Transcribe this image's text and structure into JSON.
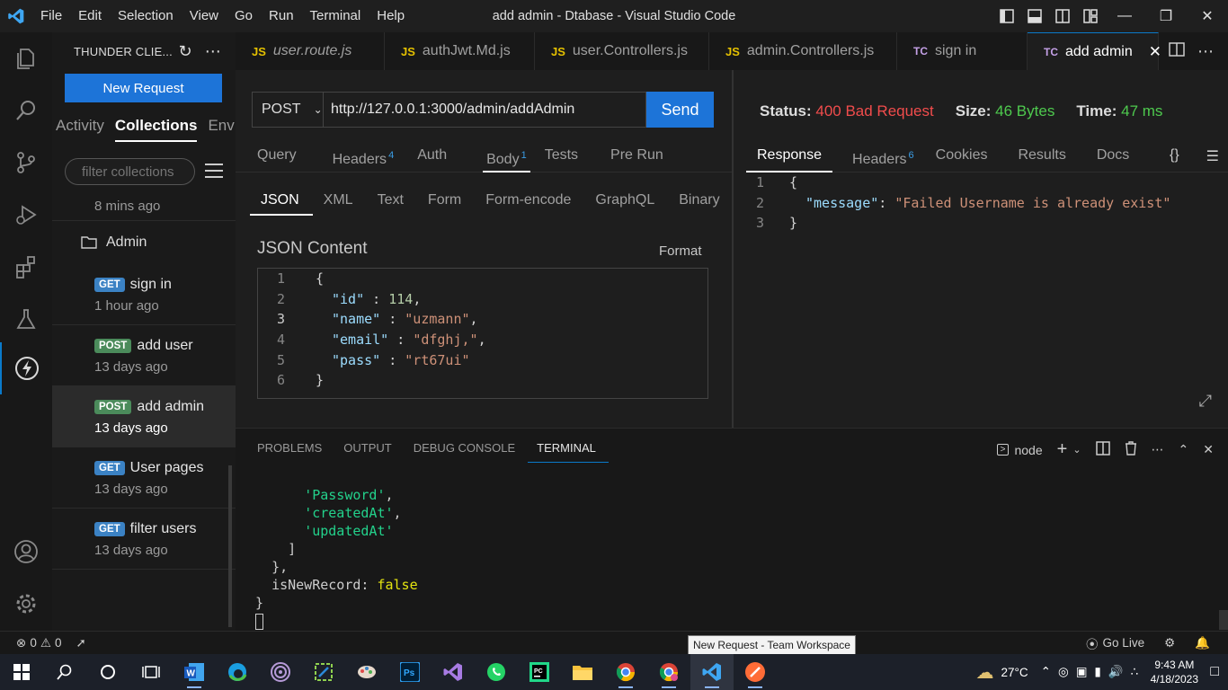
{
  "window": {
    "title": "add admin - Dtabase - Visual Studio Code"
  },
  "menu": [
    "File",
    "Edit",
    "Selection",
    "View",
    "Go",
    "Run",
    "Terminal",
    "Help"
  ],
  "sidebar": {
    "title": "THUNDER CLIE...",
    "new_request": "New Request",
    "tabs": [
      "Activity",
      "Collections",
      "Env"
    ],
    "filter_placeholder": "filter collections",
    "top_time": "8 mins ago",
    "folder": "Admin",
    "items": [
      {
        "method": "GET",
        "name": "sign in",
        "time": "1 hour ago"
      },
      {
        "method": "POST",
        "name": "add user",
        "time": "13 days ago"
      },
      {
        "method": "POST",
        "name": "add admin",
        "time": "13 days ago"
      },
      {
        "method": "GET",
        "name": "User pages",
        "time": "13 days ago"
      },
      {
        "method": "GET",
        "name": "filter users",
        "time": "13 days ago"
      }
    ]
  },
  "tabs": [
    {
      "badge": "JS",
      "name": "user.route.js"
    },
    {
      "badge": "JS",
      "name": "authJwt.Md.js"
    },
    {
      "badge": "JS",
      "name": "user.Controllers.js"
    },
    {
      "badge": "JS",
      "name": "admin.Controllers.js"
    },
    {
      "badge": "TC",
      "name": "sign in"
    },
    {
      "badge": "TC",
      "name": "add admin"
    }
  ],
  "request": {
    "method": "POST",
    "url": "http://127.0.0.1:3000/admin/addAdmin",
    "send": "Send",
    "tabs": {
      "query": "Query",
      "headers": "Headers",
      "headers_count": "4",
      "auth": "Auth",
      "body": "Body",
      "body_count": "1",
      "tests": "Tests",
      "prerun": "Pre Run"
    },
    "body_tabs": [
      "JSON",
      "XML",
      "Text",
      "Form",
      "Form-encode",
      "GraphQL",
      "Binary"
    ],
    "json_title": "JSON Content",
    "format": "Format",
    "body_lines": [
      {
        "n": "1",
        "t": "{"
      },
      {
        "n": "2",
        "key": "\"id\"",
        "sep": " : ",
        "num": "114",
        "end": ","
      },
      {
        "n": "3",
        "key": "\"name\"",
        "sep": " : ",
        "str": "\"uzmann\"",
        "end": ","
      },
      {
        "n": "4",
        "key": "\"email\"",
        "sep": " : ",
        "str": "\"dfghj,\"",
        "end": ","
      },
      {
        "n": "5",
        "key": "\"pass\"",
        "sep": " : ",
        "str": "\"rt67ui\"",
        "end": ""
      },
      {
        "n": "6",
        "t": "}"
      }
    ]
  },
  "response": {
    "status_label": "Status:",
    "status_value": "400 Bad Request",
    "size_label": "Size:",
    "size_value": "46 Bytes",
    "time_label": "Time:",
    "time_value": "47 ms",
    "tabs": {
      "response": "Response",
      "headers": "Headers",
      "headers_count": "6",
      "cookies": "Cookies",
      "results": "Results",
      "docs": "Docs"
    },
    "lines": [
      {
        "n": "1",
        "t": "{"
      },
      {
        "n": "2",
        "key": "\"message\"",
        "sep": ": ",
        "str": "\"Failed Username is already exist\""
      },
      {
        "n": "3",
        "t": "}"
      }
    ]
  },
  "panel": {
    "tabs": [
      "PROBLEMS",
      "OUTPUT",
      "DEBUG CONSOLE",
      "TERMINAL"
    ],
    "shell": "node",
    "terminal": {
      "l1": "'Password'",
      "l2": "'createdAt'",
      "l3": "'updatedAt'",
      "l4": "]",
      "l5": "},",
      "l6_key": "isNewRecord: ",
      "l6_val": "false",
      "l7": "}"
    }
  },
  "statusbar": {
    "errors": "0",
    "warnings": "0",
    "golive": "Go Live",
    "tooltip": "New Request - Team Workspace"
  },
  "taskbar": {
    "temp": "27°C",
    "time": "9:43 AM",
    "date": "4/18/2023"
  },
  "colors": {
    "accent": "#1d74d8",
    "error": "#f14c4c",
    "success": "#4ec94e",
    "json_key": "#9cdcfe",
    "json_string": "#ce9178",
    "json_number": "#b5cea8"
  }
}
